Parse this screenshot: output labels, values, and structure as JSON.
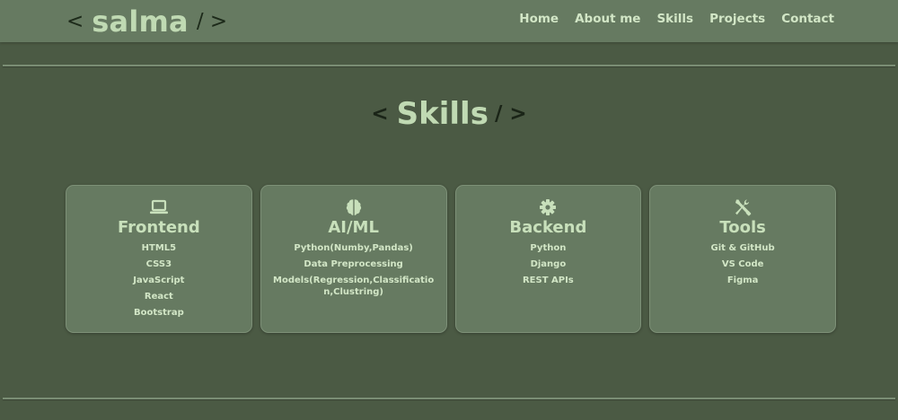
{
  "header": {
    "logo_open": "<",
    "logo_name": "salma",
    "logo_close": "/ >",
    "nav": [
      {
        "label": "Home"
      },
      {
        "label": "About me"
      },
      {
        "label": "Skills"
      },
      {
        "label": "Projects"
      },
      {
        "label": "Contact"
      }
    ]
  },
  "section": {
    "open": "<",
    "title": "Skills",
    "close": "/ >"
  },
  "cards": [
    {
      "icon": "laptop-icon",
      "title": "Frontend",
      "items": [
        "HTML5",
        "CSS3",
        "JavaScript",
        "React",
        "Bootstrap"
      ]
    },
    {
      "icon": "brain-icon",
      "title": "AI/ML",
      "items": [
        "Python(Numby,Pandas)",
        "Data Preprocessing",
        "Models(Regression,Classification,Clustring)"
      ]
    },
    {
      "icon": "gear-icon",
      "title": "Backend",
      "items": [
        "Python",
        "Django",
        "REST APIs"
      ]
    },
    {
      "icon": "tools-icon",
      "title": "Tools",
      "items": [
        "Git & GitHub",
        "VS Code",
        "Figma"
      ]
    }
  ],
  "colors": {
    "background": "#4b5a44",
    "header": "#667a61",
    "card": "#667a61",
    "accent_text": "#c0dab3",
    "bracket_text": "#1d2a1a"
  }
}
